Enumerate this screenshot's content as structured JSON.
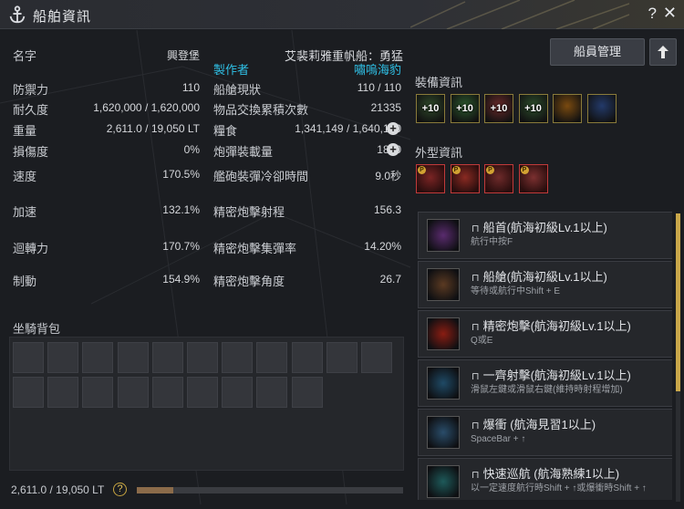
{
  "window": {
    "title": "船舶資訊",
    "help": "?",
    "close": "✕"
  },
  "stats_left": [
    {
      "label": "名字",
      "value": "興登堡"
    },
    {
      "label": "防禦力",
      "value": "110"
    },
    {
      "label": "耐久度",
      "value": "1,620,000 / 1,620,000"
    },
    {
      "label": "重量",
      "value": "2,611.0 / 19,050 LT"
    },
    {
      "label": "損傷度",
      "value": "0%"
    },
    {
      "label": "速度",
      "value": "170.5%"
    },
    {
      "label": "加速",
      "value": "132.1%"
    },
    {
      "label": "迴轉力",
      "value": "170.7%"
    },
    {
      "label": "制動",
      "value": "154.9%"
    }
  ],
  "ship_name": "艾裴莉雅重帆船：勇猛",
  "maker_label": "製作者",
  "maker_name": "嘯嗚海豹",
  "stats_right": [
    {
      "label": "船艙現狀",
      "value": "110 / 110"
    },
    {
      "label": "物品交換累積次數",
      "value": "21335"
    },
    {
      "label": "糧食",
      "value": "1,341,149 / 1,640,100"
    },
    {
      "label": "炮彈裝載量",
      "value": "1800"
    },
    {
      "label": "艦砲裝彈冷卻時間",
      "value": "9.0秒"
    },
    {
      "label": "精密炮擊射程",
      "value": "156.3"
    },
    {
      "label": "精密炮擊集彈率",
      "value": "14.20%"
    },
    {
      "label": "精密炮擊角度",
      "value": "26.7"
    }
  ],
  "mount_bag": {
    "title": "坐騎背包",
    "row1_slots": 11,
    "row2_slots": 9
  },
  "weight_footer": {
    "text": "2,611.0 / 19,050 LT",
    "fill_fraction": 0.137
  },
  "buttons": {
    "crew": "船員管理"
  },
  "equipment": {
    "title": "裝備資訊",
    "items": [
      {
        "name": "equip-slot-1",
        "level": "+10",
        "color": "#2f4a2a"
      },
      {
        "name": "equip-slot-2",
        "level": "+10",
        "color": "#2c5a2e"
      },
      {
        "name": "equip-slot-3",
        "level": "+10",
        "color": "#6a2a2a"
      },
      {
        "name": "equip-slot-4",
        "level": "+10",
        "color": "#2d4f2c"
      },
      {
        "name": "equip-slot-5",
        "level": "",
        "color": "#7a4a10"
      },
      {
        "name": "equip-slot-6",
        "level": "",
        "color": "#233a6a"
      }
    ]
  },
  "appearance": {
    "title": "外型資訊",
    "items": [
      {
        "name": "outfit-slot-1",
        "color": "#7a2424"
      },
      {
        "name": "outfit-slot-2",
        "color": "#8a2a22"
      },
      {
        "name": "outfit-slot-3",
        "color": "#6e2a2a"
      },
      {
        "name": "outfit-slot-4",
        "color": "#7b3030"
      }
    ]
  },
  "skills": [
    {
      "name": "船首(航海初級Lv.1以上)",
      "desc": "航行中按F",
      "icon": "bow-icon",
      "color": "#5a2b6e"
    },
    {
      "name": "船艙(航海初級Lv.1以上)",
      "desc": "等待或航行中Shift + E",
      "icon": "cabin-icon",
      "color": "#5b3a22"
    },
    {
      "name": "精密炮擊(航海初級Lv.1以上)",
      "desc": "Q或E",
      "icon": "crosshair-icon",
      "color": "#8a1d12"
    },
    {
      "name": "一齊射擊(航海初級Lv.1以上)",
      "desc": "滑鼠左鍵或滑鼠右鍵(維持時射程增加)",
      "icon": "broadside-icon",
      "color": "#1f4a66"
    },
    {
      "name": "爆衝 (航海見習1以上)",
      "desc": "SpaceBar + ↑",
      "icon": "boost-icon",
      "color": "#2a4d6a"
    },
    {
      "name": "快速巡航 (航海熟練1以上)",
      "desc": "以一定速度航行時Shift + ↑或爆衝時Shift + ↑",
      "icon": "cruise-icon",
      "color": "#1e5a5a"
    }
  ],
  "colors": {
    "accent_cyan": "#2fc0e6",
    "accent_gold": "#c9a74a"
  }
}
